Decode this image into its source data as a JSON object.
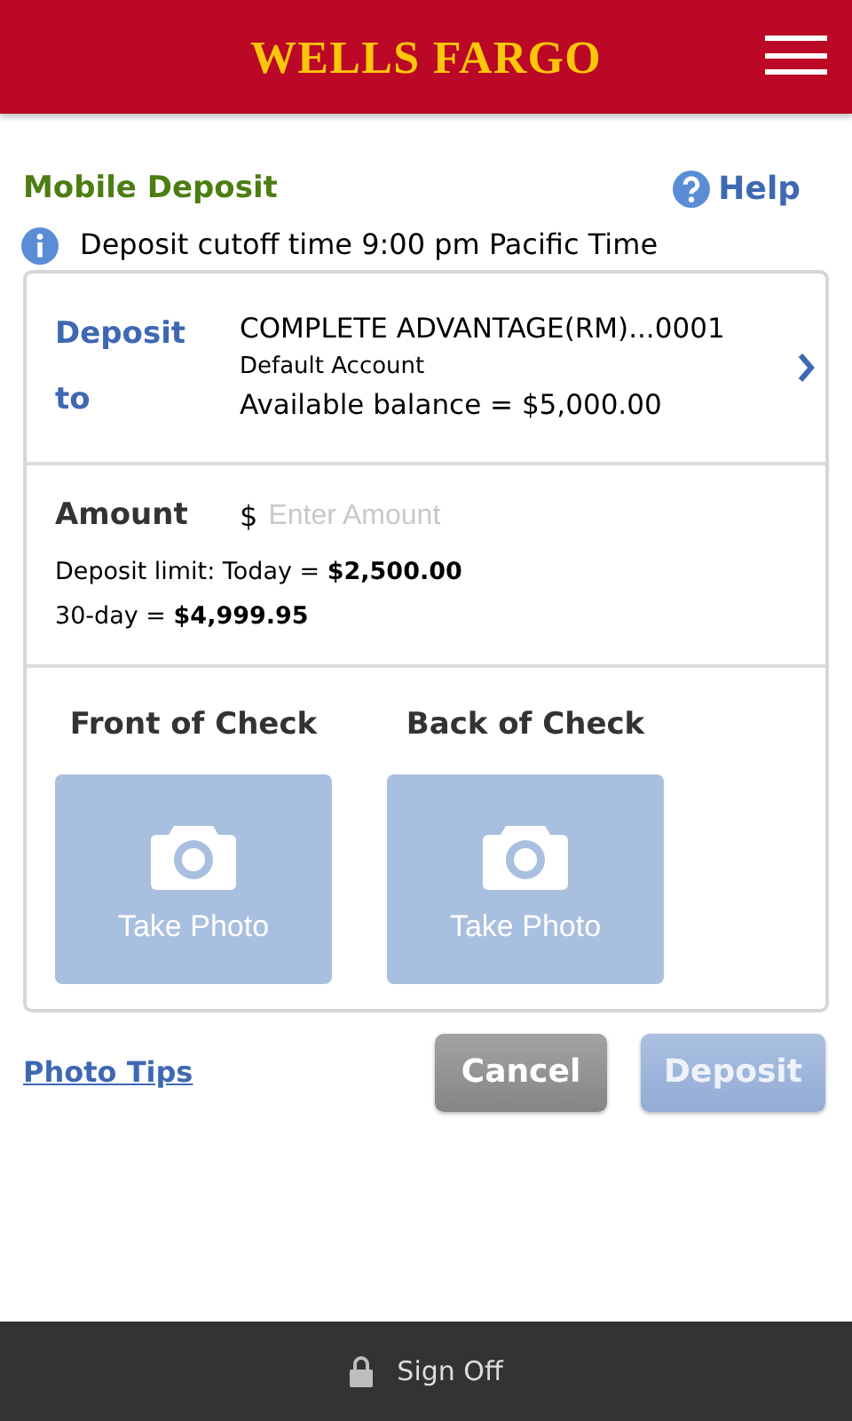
{
  "header": {
    "logo": "WELLS FARGO"
  },
  "page": {
    "title": "Mobile Deposit",
    "help": "Help",
    "notice": "Deposit cutoff time 9:00 pm Pacific Time"
  },
  "deposit_to": {
    "label_lines": [
      "Deposit",
      "to"
    ],
    "account": "COMPLETE ADVANTAGE(RM)...0001",
    "account_note": "Default Account",
    "balance": "Available balance = $5,000.00"
  },
  "amount": {
    "label": "Amount",
    "currency": "$",
    "placeholder": "Enter Amount",
    "limits": [
      "Deposit limit: Today = **$2,500.00**",
      "30-day = **$4,999.95**"
    ]
  },
  "checks": [
    {
      "title": "Front of Check",
      "action": "Take Photo"
    },
    {
      "title": "Back of Check",
      "action": "Take Photo"
    }
  ],
  "photo_tips": "Photo Tips",
  "buttons": [
    {
      "label": "Cancel",
      "kind": "secondary",
      "disabled": false
    },
    {
      "label": "Deposit",
      "kind": "primary",
      "disabled": true
    }
  ],
  "footer": {
    "sign_off": "Sign Off"
  }
}
